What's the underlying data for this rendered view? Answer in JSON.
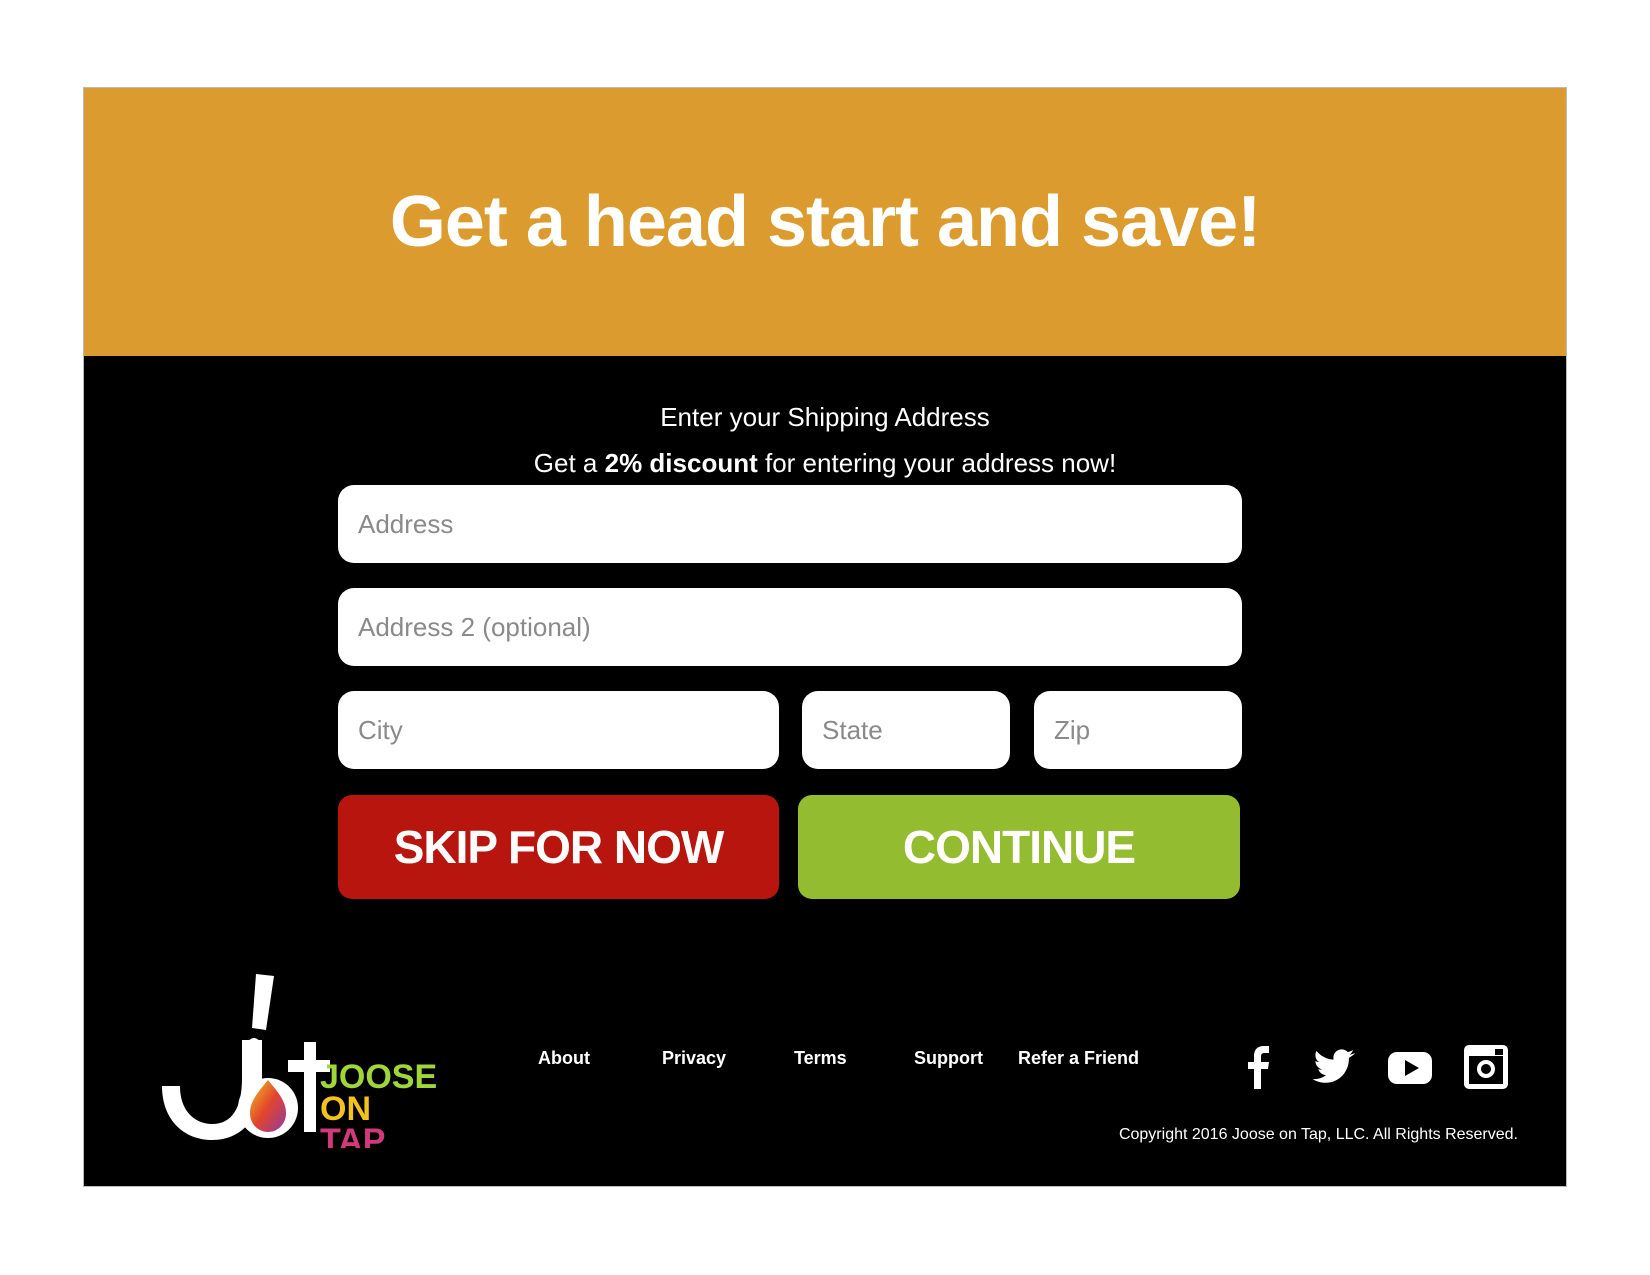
{
  "hero": {
    "title": "Get a head start and save!"
  },
  "intro": {
    "line1": "Enter your Shipping Address",
    "line2_before": "Get a ",
    "line2_bold": "2% discount",
    "line2_after": " for entering your address now!"
  },
  "form": {
    "address_placeholder": "Address",
    "address2_placeholder": "Address 2 (optional)",
    "city_placeholder": "City",
    "state_placeholder": "State",
    "zip_placeholder": "Zip"
  },
  "buttons": {
    "skip_label": "SKIP FOR NOW",
    "continue_label": "CONTINUE"
  },
  "logo": {
    "line1": "JOOSE",
    "line2": "ON",
    "line3": "TAP"
  },
  "footer": {
    "nav": [
      "About",
      "Privacy",
      "Terms",
      "Support",
      "Refer a Friend"
    ],
    "social_icons": [
      "facebook-icon",
      "twitter-icon",
      "youtube-icon",
      "instagram-icon"
    ],
    "copyright": "Copyright 2016 Joose on Tap, LLC.  All Rights Reserved."
  },
  "colors": {
    "hero_bg": "#dc9b2e",
    "skip_bg": "#b7150d",
    "continue_bg": "#93bc30",
    "body_bg": "#000000"
  }
}
